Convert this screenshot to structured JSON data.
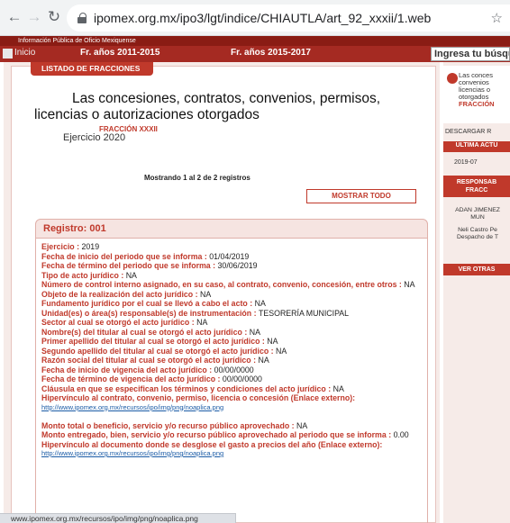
{
  "browser": {
    "url": "ipomex.org.mx/ipo3/lgt/indice/CHIAUTLA/art_92_xxxii/1.web",
    "status_url": "www.ipomex.org.mx/recursos/ipo/img/png/noaplica.png"
  },
  "site": {
    "header_text": "Información Pública de Oficio Mexiquense",
    "nav": {
      "home": "Inicio",
      "item1": "Fr. años 2011-2015",
      "item2": "Fr. años 2015-2017",
      "search_value": "Ingresa tu búsqueda"
    }
  },
  "listado_tab": "LISTADO DE FRACCIONES",
  "page": {
    "title_line1": "Las concesiones, contratos, convenios, permisos,",
    "title_line2": "licencias o autorizaciones otorgados",
    "fraccion": "FRACCIÓN XXXII",
    "ejercicio": "Ejercicio 2020",
    "mostrando": "Mostrando 1 al 2 de 2 registros",
    "mostrar_todo": "MOSTRAR TODO"
  },
  "record": {
    "title": "Registro: 001",
    "fields": [
      {
        "k": "Ejercicio",
        "v": "2019"
      },
      {
        "k": "Fecha de inicio del periodo que se informa",
        "v": "01/04/2019"
      },
      {
        "k": "Fecha de término del periodo que se informa",
        "v": "30/06/2019"
      },
      {
        "k": "Tipo de acto jurídico",
        "v": "NA"
      },
      {
        "k": "Número de control interno asignado, en su caso, al contrato, convenio, concesión, entre otros",
        "v": "NA"
      },
      {
        "k": "Objeto de la realización del acto jurídico",
        "v": "NA"
      },
      {
        "k": "Fundamento jurídico por el cual se llevó a cabo el acto",
        "v": "NA"
      },
      {
        "k": "Unidad(es) o área(s) responsable(s) de instrumentación",
        "v": "TESORERÍA MUNICIPAL"
      },
      {
        "k": "Sector al cual se otorgó el acto jurídico",
        "v": "NA"
      },
      {
        "k": "Nombre(s) del titular al cual se otorgó el acto jurídico",
        "v": "NA"
      },
      {
        "k": "Primer apellido del titular al cual se otorgó el acto jurídico",
        "v": "NA"
      },
      {
        "k": "Segundo apellido del titular al cual se otorgó el acto jurídico",
        "v": "NA"
      },
      {
        "k": "Razón social del titular al cual se otorgó el acto jurídico",
        "v": "NA"
      },
      {
        "k": "Fecha de inicio de vigencia del acto jurídico",
        "v": "00/00/0000"
      },
      {
        "k": "Fecha de término de vigencia del acto jurídico",
        "v": "00/00/0000"
      },
      {
        "k": "Cláusula en que se especifican los términos y condiciones del acto jurídico",
        "v": "NA"
      }
    ],
    "link1_label": "Hipervínculo al contrato, convenio, permiso, licencia o concesión (Enlace externo):",
    "link1_url": "http://www.ipomex.org.mx/recursos/ipo/img/png/noaplica.png",
    "monto_total_k": "Monto total o beneficio, servicio y/o recurso público aprovechado",
    "monto_total_v": "NA",
    "monto_entregado_k": "Monto entregado, bien, servicio y/o recurso público aprovechado al periodo que se informa",
    "monto_entregado_v": "0.00",
    "link2_label": "Hipervínculo al documento donde se desglose el gasto a precios del año (Enlace externo):",
    "link2_url": "http://www.ipomex.org.mx/recursos/ipo/img/png/noaplica.png"
  },
  "right": {
    "desc1": "Las conces",
    "desc2": "convenios",
    "desc3": "licencias o",
    "desc4": "otorgados",
    "frac": "FRACCIÓN",
    "descargar": "DESCARGAR R",
    "ultima": "ULTIMA ACTU",
    "date": "2019-07",
    "responsable1": "RESPONSAB",
    "responsable2": "FRACC",
    "person1": "ADAN JIMENEZ",
    "person2": "MUN",
    "person3": "Neli Castro Pe",
    "person4": "Despacho de T",
    "ver_otras": "VER OTRAS"
  }
}
